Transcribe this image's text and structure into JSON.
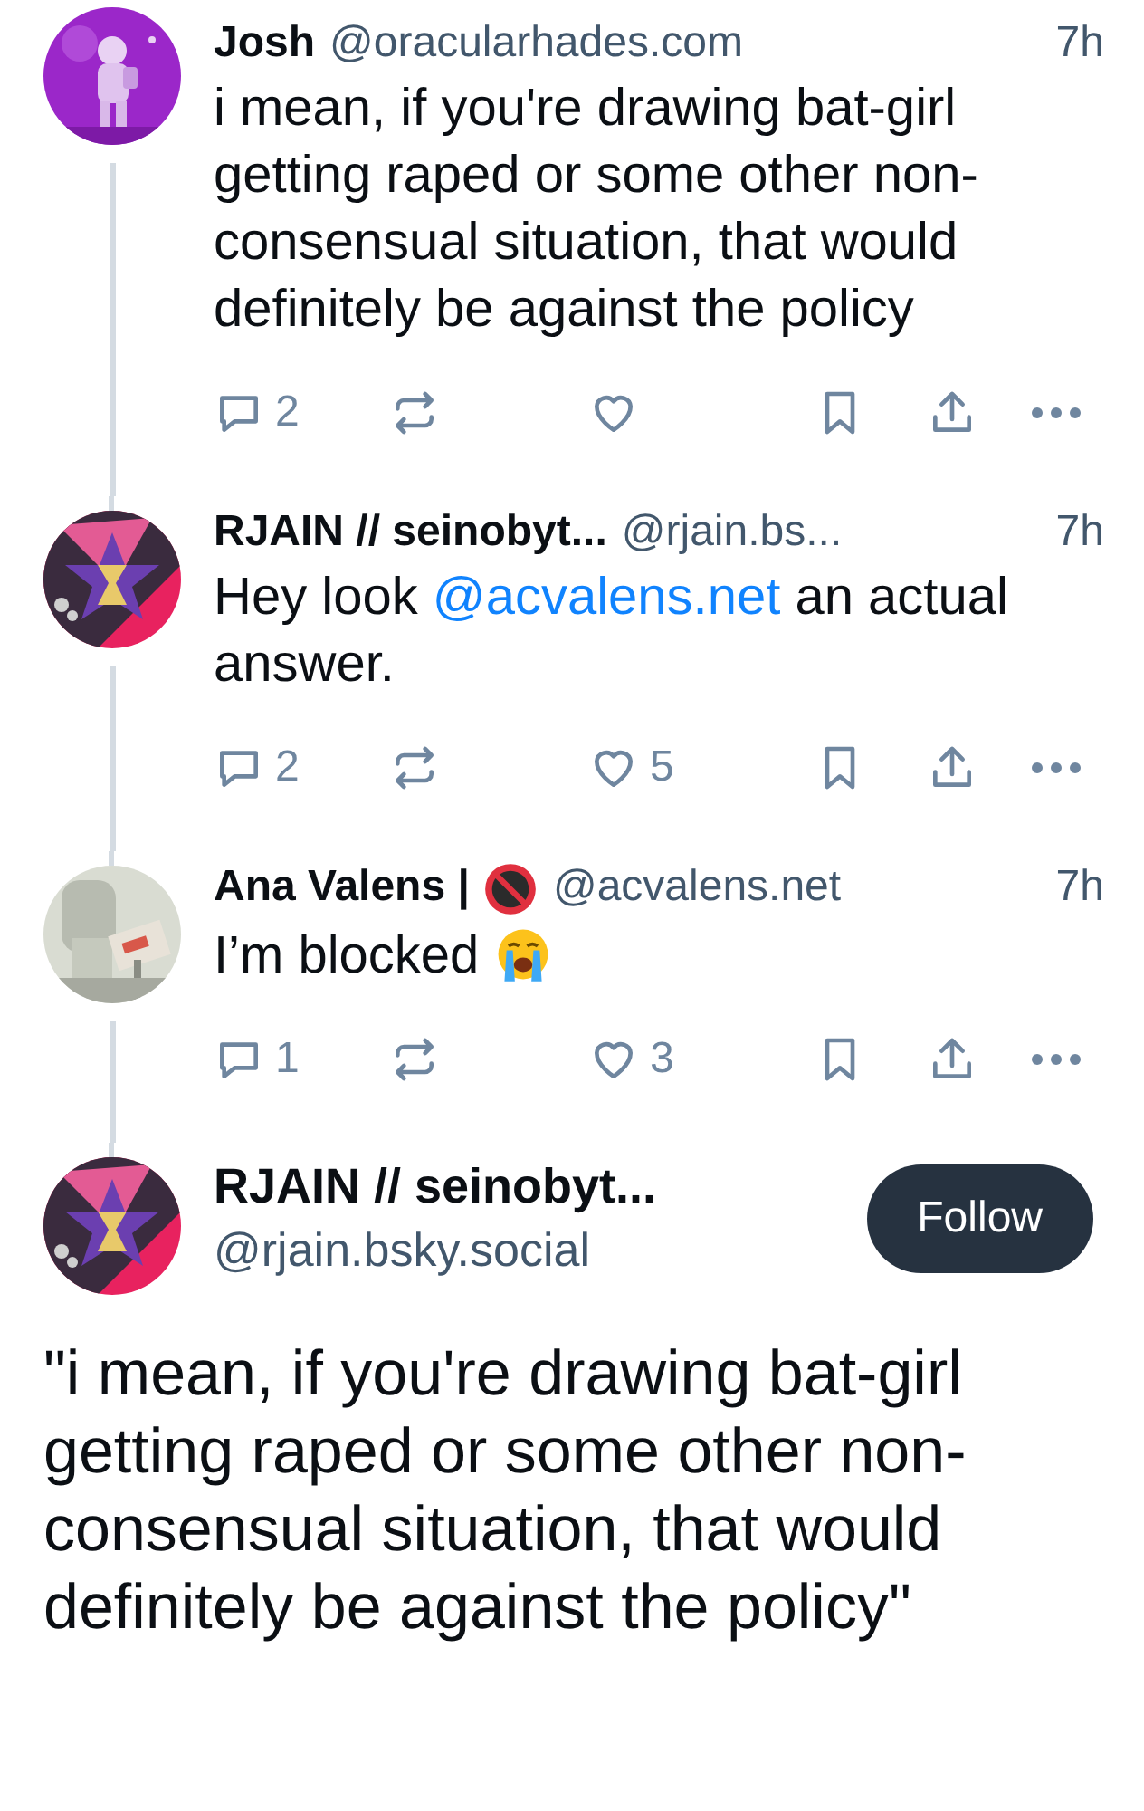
{
  "thread": [
    {
      "name": "Josh",
      "handle": "@oracularhades.com",
      "time": "7h",
      "body": [
        {
          "kind": "text",
          "text": "i mean, if you're drawing bat-girl getting raped or some other non-consensual situation, that would definitely be against the policy"
        }
      ],
      "replies": "2"
    },
    {
      "name": "RJAIN // seinobyt...",
      "handle": "@rjain.bs...",
      "time": "7h",
      "body": [
        {
          "kind": "text",
          "text": "Hey look "
        },
        {
          "kind": "mention",
          "text": "@acvalens.net"
        },
        {
          "kind": "text",
          "text": " an actual answer."
        }
      ],
      "replies": "2",
      "likes": "5"
    },
    {
      "name": "Ana Valens |",
      "age_badge": true,
      "handle": "@acvalens.net",
      "time": "7h",
      "body": [
        {
          "kind": "text",
          "text": "I’m blocked "
        },
        {
          "kind": "emoji"
        }
      ],
      "replies": "1",
      "likes": "3"
    }
  ],
  "main_post": {
    "name": "RJAIN // seinobyt...",
    "handle": "@rjain.bsky.social",
    "follow_label": "Follow",
    "text": "\"i mean, if you're drawing bat-girl getting raped or some other non-consensual situation, that would definitely be against the policy\""
  }
}
